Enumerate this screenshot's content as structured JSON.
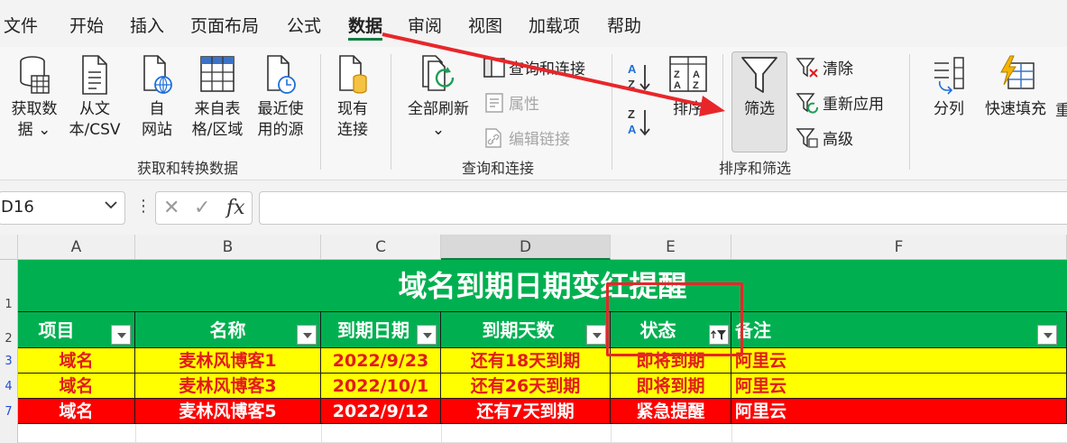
{
  "tabs": [
    "文件",
    "开始",
    "插入",
    "页面布局",
    "公式",
    "数据",
    "审阅",
    "视图",
    "加载项",
    "帮助"
  ],
  "active_tab": "数据",
  "ribbon": {
    "groups": {
      "get_transform": "获取和转换数据",
      "query_connect": "查询和连接",
      "sort_filter": "排序和筛选"
    },
    "get_data": [
      "获取数",
      "据 ⌄"
    ],
    "from_text": [
      "从文",
      "本/CSV"
    ],
    "from_web": [
      "自",
      "网站"
    ],
    "from_table": [
      "来自表",
      "格/区域"
    ],
    "recent_sources": [
      "最近使",
      "用的源"
    ],
    "existing_conn": [
      "现有",
      "连接"
    ],
    "refresh_all": [
      "全部刷新",
      "⌄"
    ],
    "queries_conn": "查询和连接",
    "properties": "属性",
    "edit_links": "编辑链接",
    "sort": "排序",
    "filter": "筛选",
    "clear": "清除",
    "reapply": "重新应用",
    "advanced": "高级",
    "text_to_columns": "分列",
    "flash_fill": "快速填充",
    "cut_label": "重"
  },
  "formula_bar": {
    "name_box": "D16",
    "formula": ""
  },
  "grid": {
    "columns": [
      "A",
      "B",
      "C",
      "D",
      "E",
      "F"
    ],
    "selected_column": "D",
    "row_numbers": [
      "1",
      "2",
      "3",
      "4",
      "7"
    ],
    "title": "域名到期日期变红提醒",
    "headers": [
      "项目",
      "名称",
      "到期日期",
      "到期天数",
      "状态",
      "备注"
    ],
    "filtered_column": "状态",
    "rows": [
      {
        "style": "yellow",
        "cells": [
          "域名",
          "麦林风博客1",
          "2022/9/23",
          "还有18天到期",
          "即将到期",
          "阿里云"
        ]
      },
      {
        "style": "yellow",
        "cells": [
          "域名",
          "麦林风博客3",
          "2022/10/1",
          "还有26天到期",
          "即将到期",
          "阿里云"
        ]
      },
      {
        "style": "red",
        "cells": [
          "域名",
          "麦林风博客5",
          "2022/9/12",
          "还有7天到期",
          "紧急提醒",
          "阿里云"
        ]
      }
    ]
  },
  "colors": {
    "header_green": "#00b050",
    "row_yellow": "#ffff00",
    "row_red": "#ff0000",
    "annotation_red": "#e8262a",
    "accent": "#107c41"
  }
}
